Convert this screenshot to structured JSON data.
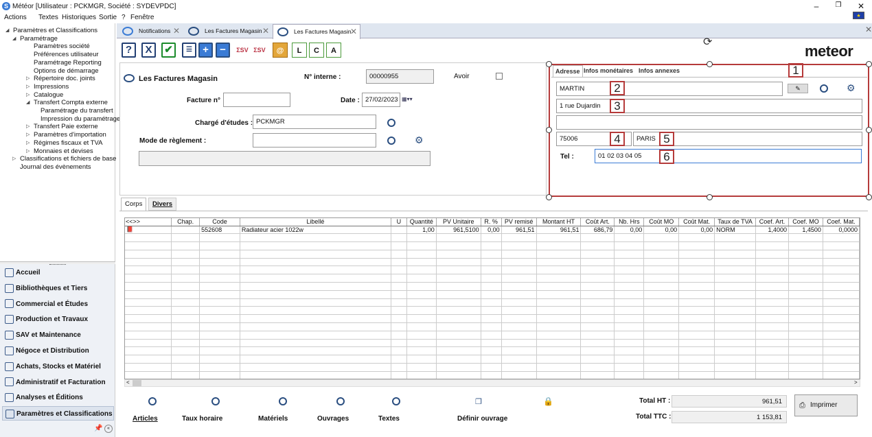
{
  "window": {
    "title": "Météor [Utilisateur : PCKMGR, Société : SYDEVPDC]",
    "controls": [
      "–",
      "❐",
      "✕"
    ]
  },
  "menu": [
    "Actions",
    "Textes",
    "Historiques",
    "Sortie",
    "?",
    "Fenêtre"
  ],
  "tree": [
    {
      "label": "Paramètres et Classifications",
      "level": 0,
      "twisty": "◢"
    },
    {
      "label": "Paramétrage",
      "level": 1,
      "twisty": "◢"
    },
    {
      "label": "Paramètres société",
      "level": 2
    },
    {
      "label": "Préférences utilisateur",
      "level": 2
    },
    {
      "label": "Paramétrage Reporting",
      "level": 2
    },
    {
      "label": "Options de démarrage",
      "level": 2
    },
    {
      "label": "Répertoire doc. joints",
      "level": 2,
      "twisty": "▷"
    },
    {
      "label": "Impressions",
      "level": 2,
      "twisty": "▷"
    },
    {
      "label": "Catalogue",
      "level": 2,
      "twisty": "▷"
    },
    {
      "label": "Transfert Compta externe",
      "level": 2,
      "twisty": "◢"
    },
    {
      "label": "Paramétrage du transfert",
      "level": 3
    },
    {
      "label": "Impression du paramétrage",
      "level": 3
    },
    {
      "label": "Transfert Paie externe",
      "level": 2,
      "twisty": "▷"
    },
    {
      "label": "Paramètres d'importation",
      "level": 2,
      "twisty": "▷"
    },
    {
      "label": "Régimes fiscaux et TVA",
      "level": 2,
      "twisty": "▷"
    },
    {
      "label": "Monnaies et devises",
      "level": 2,
      "twisty": "▷"
    },
    {
      "label": "Classifications et fichiers de base",
      "level": 1,
      "twisty": "▷"
    },
    {
      "label": "Journal des évènements",
      "level": 1
    }
  ],
  "nav": [
    {
      "label": "Accueil",
      "active": false
    },
    {
      "label": "Bibliothèques et Tiers",
      "active": false
    },
    {
      "label": "Commercial et Études",
      "active": false
    },
    {
      "label": "Production et Travaux",
      "active": false
    },
    {
      "label": "SAV et Maintenance",
      "active": false
    },
    {
      "label": "Négoce et Distribution",
      "active": false
    },
    {
      "label": "Achats, Stocks et Matériel",
      "active": false
    },
    {
      "label": "Administratif et Facturation",
      "active": false
    },
    {
      "label": "Analyses et Éditions",
      "active": false
    },
    {
      "label": "Paramètres et Classifications",
      "active": true
    }
  ],
  "tabs": [
    {
      "label": "Notifications"
    },
    {
      "label": "Les Factures Magasin"
    },
    {
      "label": "Les Factures Magasin",
      "active": true
    }
  ],
  "toolbar": {
    "help": "?",
    "cancel": "X",
    "validate": "✔",
    "add": "+",
    "remove": "−",
    "sv_add": "ΣSV",
    "sv_remove": "ΣSV",
    "l_label": "L",
    "c_label": "C",
    "a_label": "A"
  },
  "logo": "meteor",
  "form": {
    "title": "Les Factures Magasin",
    "num_interne_label": "N° interne :",
    "num_interne_value": "00000955",
    "avoir_label": "Avoir",
    "facture_label": "Facture n°",
    "facture_value": "",
    "date_label": "Date :",
    "date_value": "27/02/2023",
    "charge_label": "Chargé d'études :",
    "charge_value": "PCKMGR",
    "mode_label": "Mode de règlement :",
    "mode_value": ""
  },
  "address": {
    "tabs": [
      "Adresse",
      "Infos monétaires",
      "Infos annexes"
    ],
    "name": "MARTIN",
    "street": "1 rue Dujardin",
    "street2": "",
    "postcode": "75006",
    "city": "PARIS",
    "tel_label": "Tel :",
    "tel_value": "01 02 03 04 05",
    "markers": [
      "1",
      "2",
      "3",
      "4",
      "5",
      "6"
    ]
  },
  "lower_tabs": [
    "Corps",
    "Divers"
  ],
  "grid": {
    "nav_header": "<<>>",
    "columns": [
      "Chap.",
      "Code",
      "Libellé",
      "U",
      "Quantité",
      "PV Unitaire",
      "R. %",
      "PV remisé",
      "Montant HT",
      "Coût Art.",
      "Nb. Hrs",
      "Coût MO",
      "Coût Mat.",
      "Taux de TVA",
      "Coef. Art.",
      "Coef. MO",
      "Coef. Mat."
    ],
    "rows": [
      [
        "",
        "552608",
        "Radiateur acier 1022w",
        "",
        "1,00",
        "961,5100",
        "0,00",
        "961,51",
        "961,51",
        "686,79",
        "0,00",
        "0,00",
        "0,00",
        "NORM",
        "1,4000",
        "1,4500",
        "0,0000"
      ]
    ]
  },
  "bottom_actions": [
    {
      "label": "Articles",
      "u": "A"
    },
    {
      "label": "Taux horaire",
      "u": "T"
    },
    {
      "label": "Matériels",
      "u": "M"
    },
    {
      "label": "Ouvrages",
      "u": "u"
    },
    {
      "label": "Textes",
      "u": "x"
    },
    {
      "label": "Définir ouvrage",
      "u": ""
    }
  ],
  "totals": {
    "ht_label": "Total HT :",
    "ht_value": "961,51",
    "ttc_label": "Total TTC :",
    "ttc_value": "1 153,81"
  },
  "print_label": "Imprimer"
}
